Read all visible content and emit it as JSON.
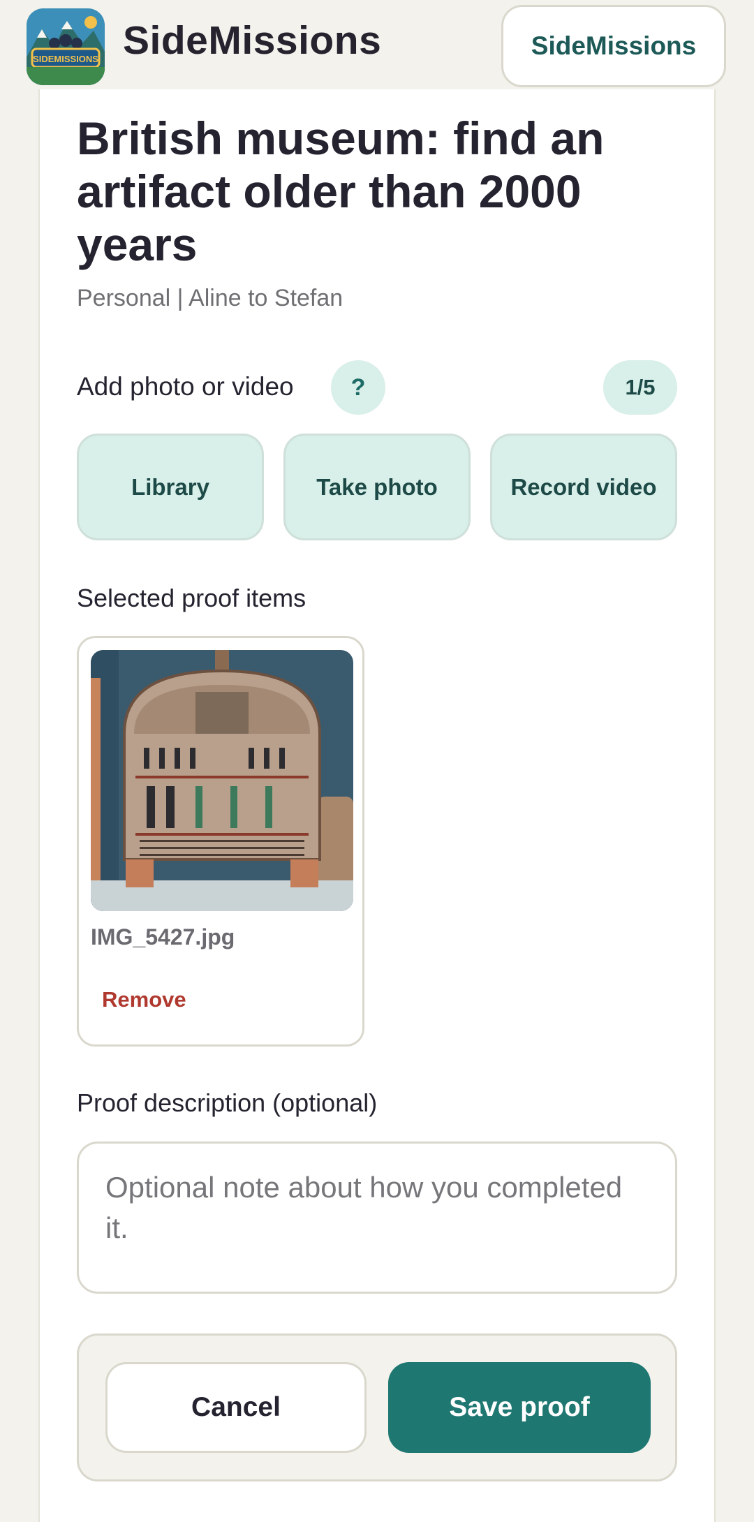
{
  "header": {
    "app_name": "SideMissions",
    "pill_label": "SideMissions",
    "logo_icon": "sidemissions-logo-icon",
    "logo_text": "SIDEMISSIONS"
  },
  "mission": {
    "title": "British museum: find an artifact older than 2000 years",
    "subtitle": "Personal | Aline to Stefan"
  },
  "media": {
    "add_label": "Add photo or video",
    "help_label": "?",
    "count": "1/5",
    "buttons": {
      "library": "Library",
      "take_photo": "Take photo",
      "record_video": "Record video"
    }
  },
  "proof": {
    "heading": "Selected proof items",
    "items": [
      {
        "filename": "IMG_5427.jpg",
        "remove_label": "Remove",
        "thumbnail": "museum-stele-photo"
      }
    ]
  },
  "description": {
    "label": "Proof description (optional)",
    "placeholder": "Optional note about how you completed it.",
    "value": ""
  },
  "actions": {
    "cancel_label": "Cancel",
    "save_label": "Save proof"
  },
  "colors": {
    "brand": "#1f7772",
    "accent_light": "#d9efe9",
    "danger": "#b0392f",
    "background": "#f3f2ed"
  }
}
